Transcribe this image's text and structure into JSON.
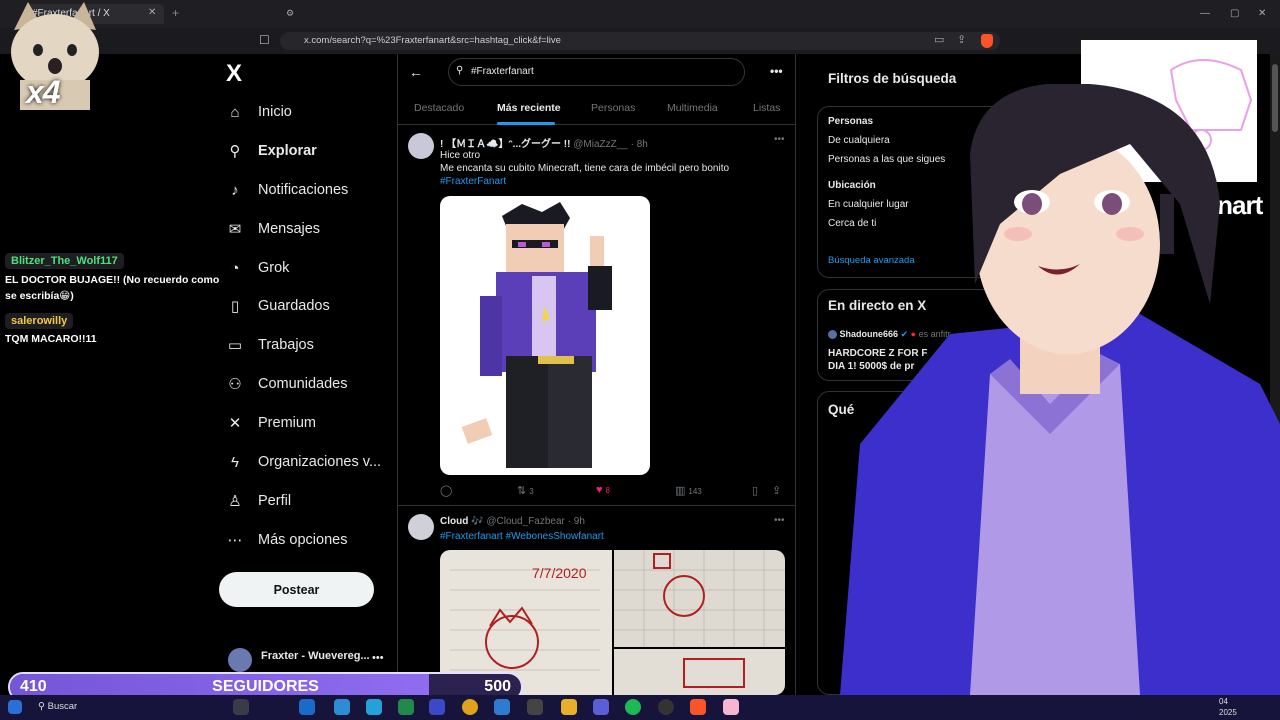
{
  "browser": {
    "tab_title": "#Fraxterfanart / X",
    "url": "x.com/search?q=%23Fraxterfanart&src=hashtag_click&f=live",
    "win_min": "—",
    "win_max": "▢",
    "win_close": "✕"
  },
  "overlay": {
    "cat_label": "x4",
    "followers_current": "410",
    "followers_label": "SEGUIDORES",
    "followers_goal": "500",
    "followers_progress": 0.82,
    "chat": [
      {
        "user": "Blitzer_The_Wolf117",
        "user_color": "#4ee07a",
        "message": "EL DOCTOR BUJAGE!! (No recuerdo como se escribía😁)"
      },
      {
        "user": "salerowilly",
        "user_color": "#f5c842",
        "message": "TQM MACARO!!11"
      }
    ],
    "sketch_caption": "fanart"
  },
  "nav": {
    "logo": "X",
    "items": [
      {
        "label": "Inicio",
        "icon": "home-icon"
      },
      {
        "label": "Explorar",
        "icon": "search-icon"
      },
      {
        "label": "Notificaciones",
        "icon": "bell-icon"
      },
      {
        "label": "Mensajes",
        "icon": "mail-icon"
      },
      {
        "label": "Grok",
        "icon": "grok-icon"
      },
      {
        "label": "Guardados",
        "icon": "bookmark-icon"
      },
      {
        "label": "Trabajos",
        "icon": "briefcase-icon"
      },
      {
        "label": "Comunidades",
        "icon": "people-icon"
      },
      {
        "label": "Premium",
        "icon": "x-icon"
      },
      {
        "label": "Organizaciones v...",
        "icon": "lightning-icon"
      },
      {
        "label": "Perfil",
        "icon": "person-icon"
      },
      {
        "label": "Más opciones",
        "icon": "more-circle-icon"
      }
    ],
    "post_label": "Postear",
    "account_name": "Fraxter - Wuevereg..."
  },
  "search": {
    "query": "#Fraxterfanart",
    "tabs": [
      "Destacado",
      "Más reciente",
      "Personas",
      "Multimedia",
      "Listas"
    ],
    "active_tab": "Más reciente"
  },
  "tweets": [
    {
      "name": "! 【ＭＩＡ☁️】ᵔ...グーグー !!",
      "handle": "@MiaZzZ__",
      "time": "8h",
      "lines": [
        "Hice otro",
        "Me encanta su cubito Minecraft, tiene cara de imbécil pero bonito"
      ],
      "hashtags": "#FraxterFanart",
      "replies": "",
      "retweets": "3",
      "likes": "8",
      "views": "143"
    },
    {
      "name": "Cloud 🎶",
      "handle": "@Cloud_Fazbear",
      "time": "9h",
      "hashtag_1": "#Fraxterfanart",
      "hashtag_2": "#WebonesShowfanart",
      "paper_date": "7/7/2020"
    }
  ],
  "filters": {
    "title": "Filtros de búsqueda",
    "people_heading": "Personas",
    "people_options": [
      "De cualquiera",
      "Personas a las que sigues"
    ],
    "location_heading": "Ubicación",
    "location_options": [
      "En cualquier lugar",
      "Cerca de ti"
    ],
    "advanced": "Búsqueda avanzada"
  },
  "live": {
    "title": "En directo en X",
    "host": "Shadoune666",
    "host_suffix": "es anfitr",
    "stream_title": "HARDCORE Z FOR F DIA 1! 5000$ de pr"
  },
  "trends": {
    "title": "Qué"
  },
  "taskbar": {
    "search_label": "Buscar",
    "time": "04",
    "date": "2025"
  },
  "colors": {
    "accent": "#1d9bf0",
    "like": "#f91880",
    "bar_fill": "#7456d8"
  }
}
